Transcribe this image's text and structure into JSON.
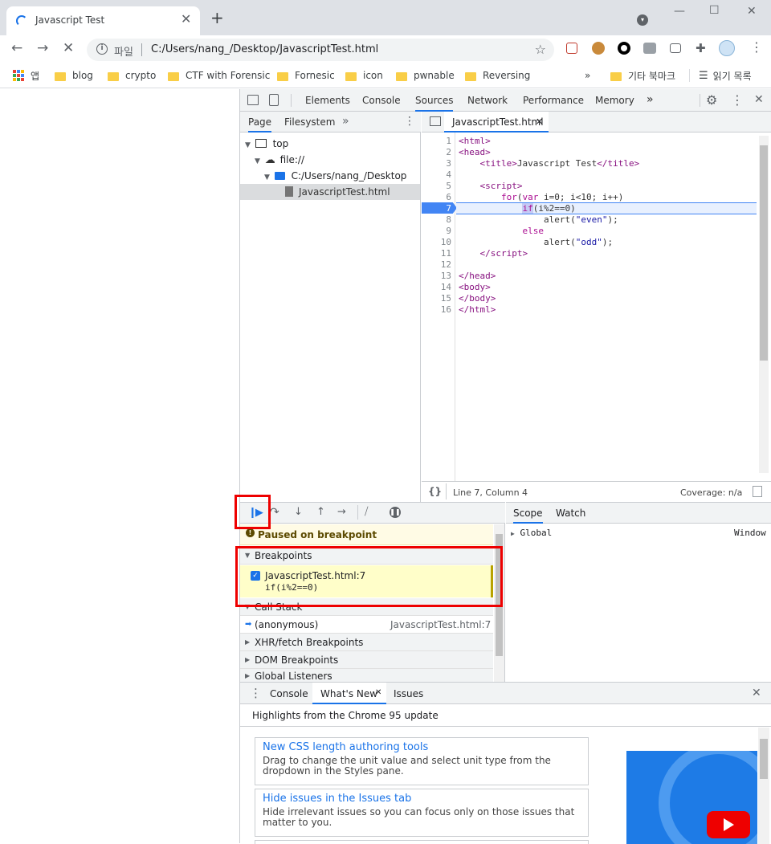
{
  "browser": {
    "tab_title": "Javascript Test",
    "close_tab": "✕",
    "new_tab": "+",
    "address_label": "파일",
    "url": "C:/Users/nang_/Desktop/JavascriptTest.html"
  },
  "bookmarks": {
    "apps": "앱",
    "items": [
      "blog",
      "crypto",
      "CTF with Forensic",
      "Fornesic",
      "icon",
      "pwnable",
      "Reversing"
    ],
    "more": "»",
    "other": "기타 북마크",
    "reading": "읽기 목록"
  },
  "devtools": {
    "tabs": [
      "Elements",
      "Console",
      "Sources",
      "Network",
      "Performance",
      "Memory"
    ],
    "active_tab": "Sources",
    "more": "»",
    "navigator": {
      "tabs": [
        "Page",
        "Filesystem"
      ],
      "more": "»",
      "tree": {
        "top": "top",
        "origin": "file://",
        "folder": "C:/Users/nang_/Desktop",
        "file": "JavascriptTest.html"
      }
    },
    "editor": {
      "file_tab": "JavascriptTest.html",
      "close": "✕",
      "line_numbers": [
        "1",
        "2",
        "3",
        "4",
        "5",
        "6",
        "7",
        "8",
        "9",
        "10",
        "11",
        "12",
        "13",
        "14",
        "15",
        "16"
      ],
      "status_position": "Line 7, Column 4",
      "coverage": "Coverage: n/a",
      "pretty": "{}"
    },
    "debugger": {
      "paused": "Paused on breakpoint",
      "breakpoints_header": "Breakpoints",
      "breakpoint_file": "JavascriptTest.html:7",
      "breakpoint_code": "if(i%2==0)",
      "callstack_header": "Call Stack",
      "frame_name": "(anonymous)",
      "frame_loc": "JavascriptTest.html:7",
      "xhr": "XHR/fetch Breakpoints",
      "dom": "DOM Breakpoints",
      "global": "Global Listeners"
    },
    "scope": {
      "tabs": [
        "Scope",
        "Watch"
      ],
      "global": "Global",
      "global_value": "Window"
    },
    "drawer": {
      "tabs": [
        "Console",
        "What's New",
        "Issues"
      ],
      "close_tab": "✕",
      "headline": "Highlights from the Chrome 95 update",
      "cards": [
        {
          "title": "New CSS length authoring tools",
          "desc": "Drag to change the unit value and select unit type from the dropdown in the Styles pane."
        },
        {
          "title": "Hide issues in the Issues tab",
          "desc": "Hide irrelevant issues so you can focus only on those issues that matter to you."
        }
      ]
    }
  }
}
